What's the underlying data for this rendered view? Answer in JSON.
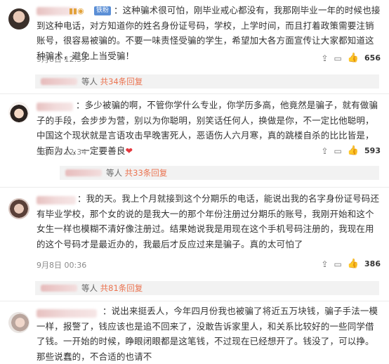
{
  "comments": [
    {
      "badge": "铁粉",
      "text": "：这种骗术很可怕，刚毕业戒心都没有，我那刚毕业一年的时候也接到这种电话，对方知道你的姓名身份证号码，学校，上学时间，而且打着政策需要注销账号，很容易被骗的。不要一味责怪受骗的学生，希望加大各方面宣传让大家都知道这种骗术，避免上当受骗！",
      "time": "9月8日 12:59",
      "likes": "656",
      "reply": {
        "prefix": "等人",
        "link": "共34条回复"
      }
    },
    {
      "text": "：多少被骗的啊，不管你学什么专业，你学历多高，他竟然是骗子，就有做骗子的手段，会步步为营，别以为你聪明，别笑话任何人，换做是你，不一定比他聪明，中国这个现状就是言语攻击早晚害死人，恶语伤人六月寒，真的跳楼自杀的比比皆是，生而为人，一定要善良",
      "time": "9月8日 12:34",
      "likes": "593",
      "reply": {
        "prefix": "等人",
        "link": "共33条回复"
      }
    },
    {
      "text": "：我的天。我上个月就接到这个分期乐的电话，能说出我的名字身份证号码还有毕业学校，那个女的说的是我大一的那个年份注册过分期乐的账号，我刚开始和这个女生一样也模糊不清好像注册过。结果她说我是用现在这个手机号码注册的，我现在用的这个号码才是最近办的，我最后才反应过来是骗子。真的太可怕了",
      "time": "9月8日 00:36",
      "likes": "386",
      "reply": {
        "prefix": "等人",
        "link": "共81条回复"
      }
    },
    {
      "text": "：说出来挺丢人，今年四月份我也被骗了将近五万块钱，骗子手法一模一样，报警了，钱应该也是追不回来了，没敢告诉家里人，和关系比较好的一些同学借了钱。一开始的时候，睁眼闭眼都是这笔钱，不过现在已经想开了。钱没了，可以挣。那些说蠢的，不合适的也请不"
    }
  ],
  "icons": {
    "share": "share-icon",
    "comment": "comment-icon",
    "like": "thumbs-up-icon"
  },
  "colors": {
    "reply_link": "#eb7350",
    "badge": "#5b8fd6",
    "heart": "#e5393f"
  }
}
